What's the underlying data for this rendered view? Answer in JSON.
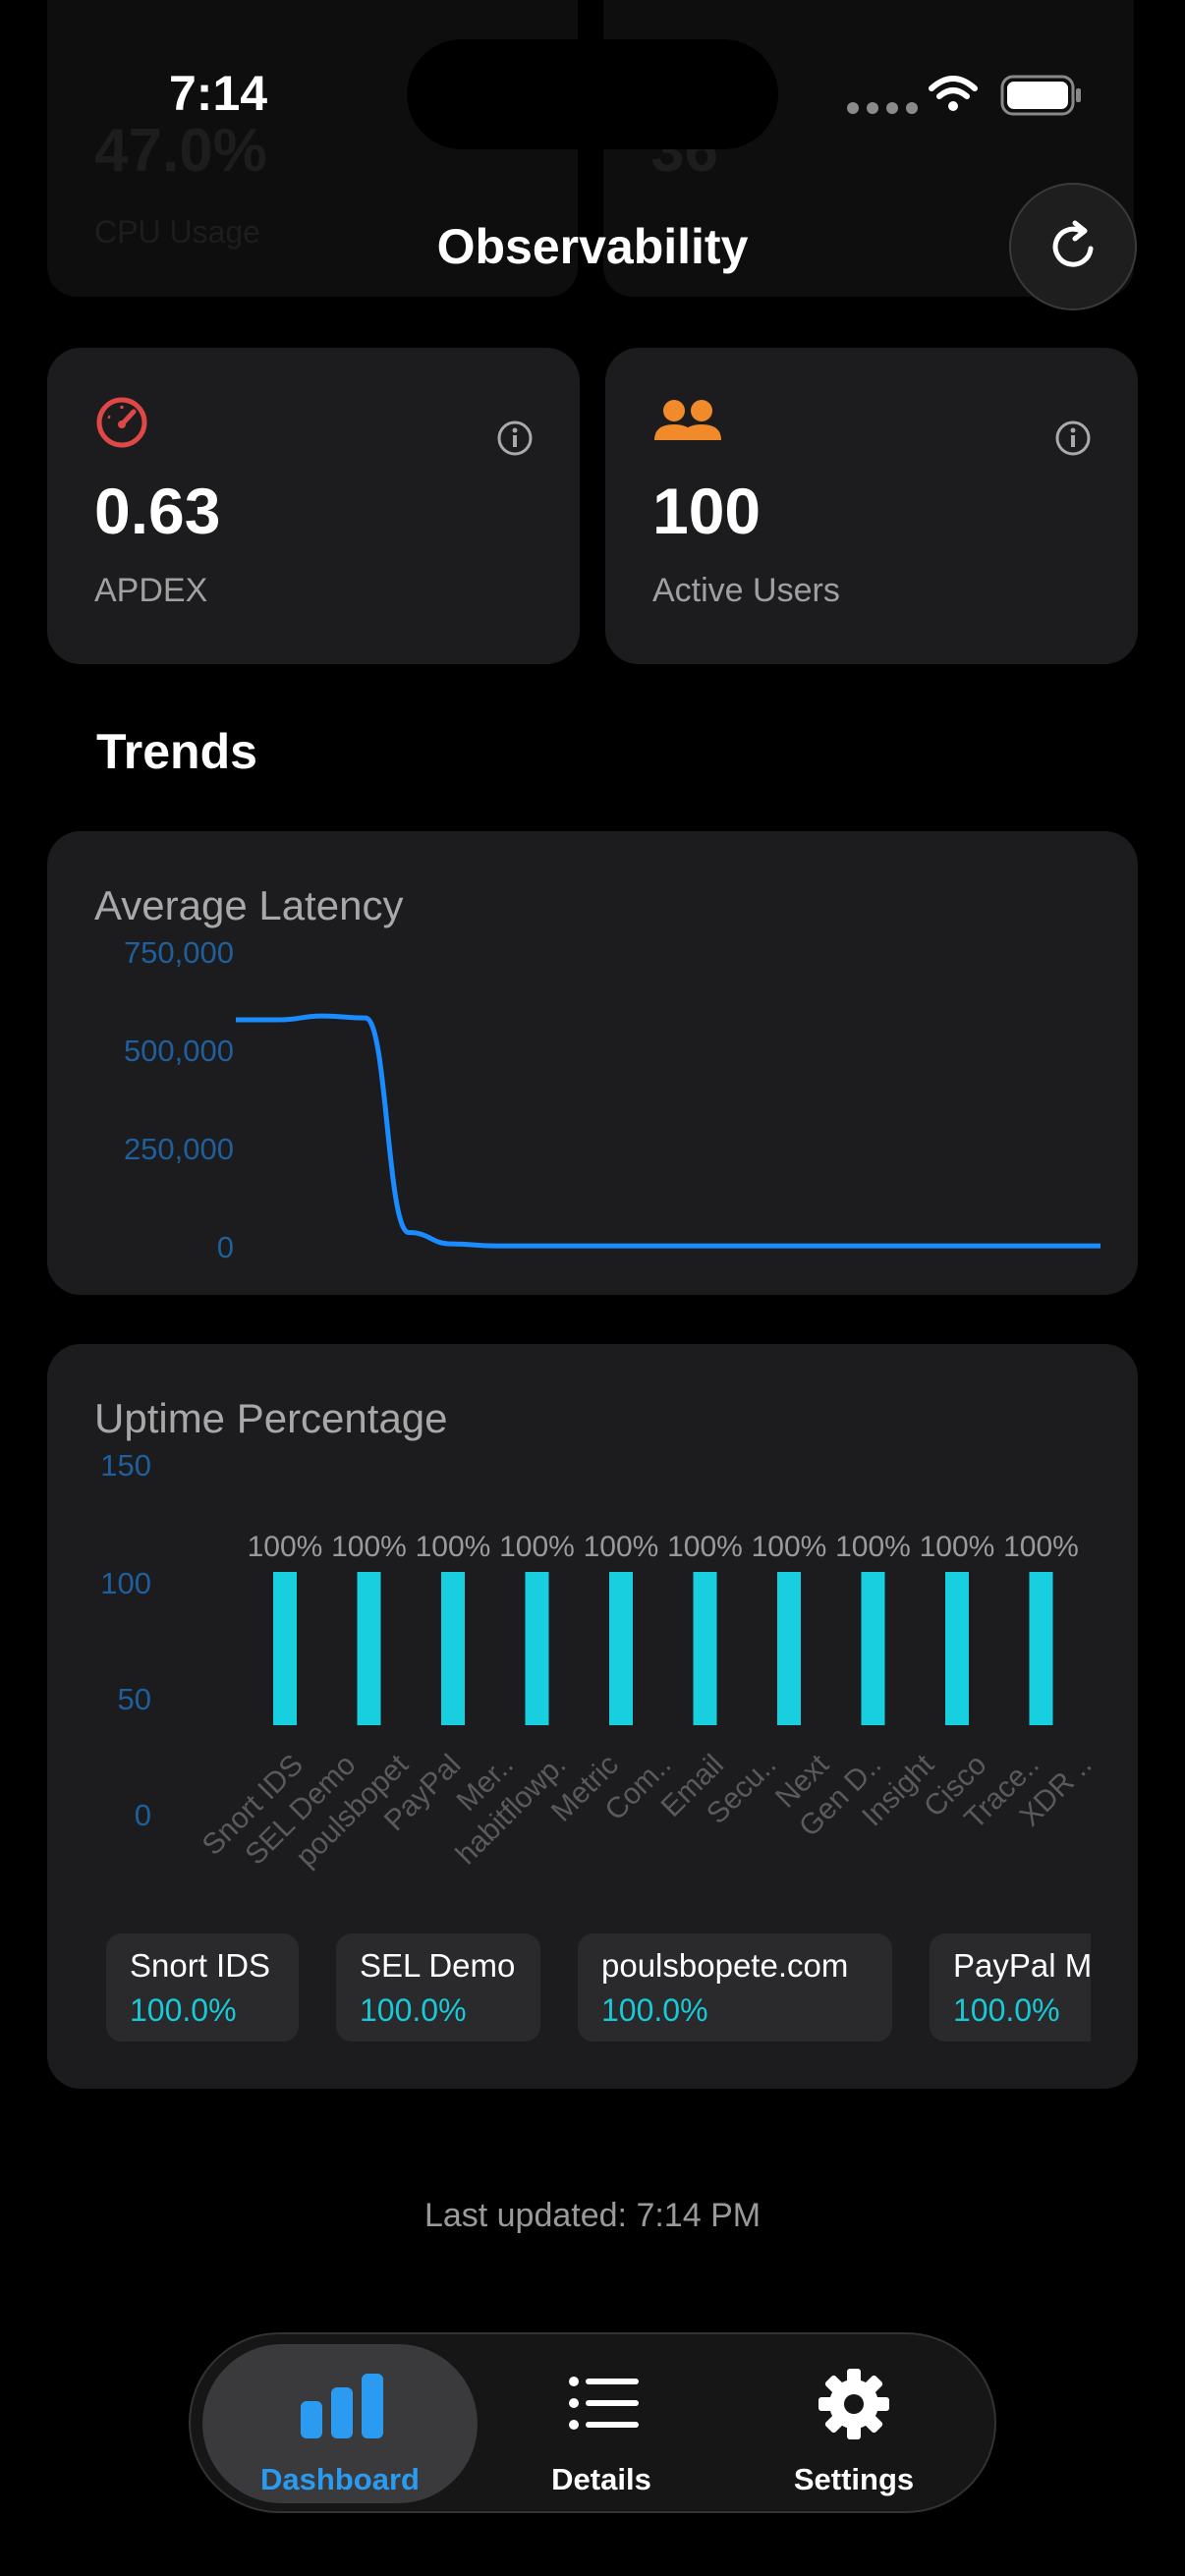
{
  "ghost": {
    "left_value": "47.0%",
    "left_label": "CPU Usage",
    "right_value": "36"
  },
  "status_bar": {
    "time": "7:14"
  },
  "header": {
    "title": "Observability"
  },
  "metrics": [
    {
      "value": "0.63",
      "label": "APDEX",
      "icon": "speedometer-icon",
      "color": "#e04848"
    },
    {
      "value": "100",
      "label": "Active Users",
      "icon": "people-icon",
      "color": "#f08a2a"
    }
  ],
  "trends_title": "Trends",
  "latency": {
    "title": "Average Latency",
    "y_ticks": [
      "750,000",
      "500,000",
      "250,000",
      "0"
    ]
  },
  "uptime": {
    "title": "Uptime Percentage",
    "y_ticks": [
      "150",
      "100",
      "50",
      "0"
    ],
    "bar_labels": [
      "100%",
      "100%",
      "100%",
      "100%",
      "100%",
      "100%",
      "100%",
      "100%",
      "100%",
      "100%"
    ],
    "x_labels": [
      "Snort IDS",
      "SEL Demo",
      "poulsbopet",
      "PayPal",
      "Mer..",
      "habitflowp.",
      "Metric",
      "Com..",
      "Email",
      "Secu..",
      "Next",
      "Gen D..",
      "Insight",
      "Cisco",
      "Trace..",
      "XDR .."
    ],
    "legend": [
      {
        "name": "Snort IDS",
        "value": "100.0%"
      },
      {
        "name": "SEL Demo",
        "value": "100.0%"
      },
      {
        "name": "poulsbopete.com",
        "value": "100.0%"
      },
      {
        "name": "PayPal M",
        "value": "100.0%"
      }
    ]
  },
  "chart_data": [
    {
      "type": "line",
      "title": "Average Latency",
      "ylim": [
        0,
        750000
      ],
      "x": [
        0,
        1,
        2,
        3,
        4,
        5,
        6,
        7,
        8,
        9,
        10,
        11,
        12,
        13,
        14,
        15,
        16,
        17,
        18,
        19,
        20
      ],
      "series": [
        {
          "values": [
            600000,
            600000,
            610000,
            605000,
            40000,
            10000,
            5000,
            5000,
            5000,
            5000,
            5000,
            5000,
            5000,
            5000,
            5000,
            5000,
            5000,
            5000,
            5000,
            5000,
            5000
          ]
        }
      ],
      "color": "#1a8cff"
    },
    {
      "type": "bar",
      "title": "Uptime Percentage",
      "ylim": [
        0,
        150
      ],
      "categories": [
        "Snort IDS",
        "SEL Demo",
        "poulsbopete.com",
        "PayPal Mer..",
        "habitflowp..",
        "Metric Com..",
        "Email Secu..",
        "Next Gen D..",
        "Insight",
        "Cisco XDR .."
      ],
      "values": [
        100,
        100,
        100,
        100,
        100,
        100,
        100,
        100,
        100,
        100
      ],
      "color": "#18cfe0"
    }
  ],
  "last_updated": "Last updated: 7:14 PM",
  "tabs": [
    {
      "label": "Dashboard",
      "icon": "chart-bar-icon",
      "active": true
    },
    {
      "label": "Details",
      "icon": "list-icon",
      "active": false
    },
    {
      "label": "Settings",
      "icon": "gear-icon",
      "active": false
    }
  ]
}
